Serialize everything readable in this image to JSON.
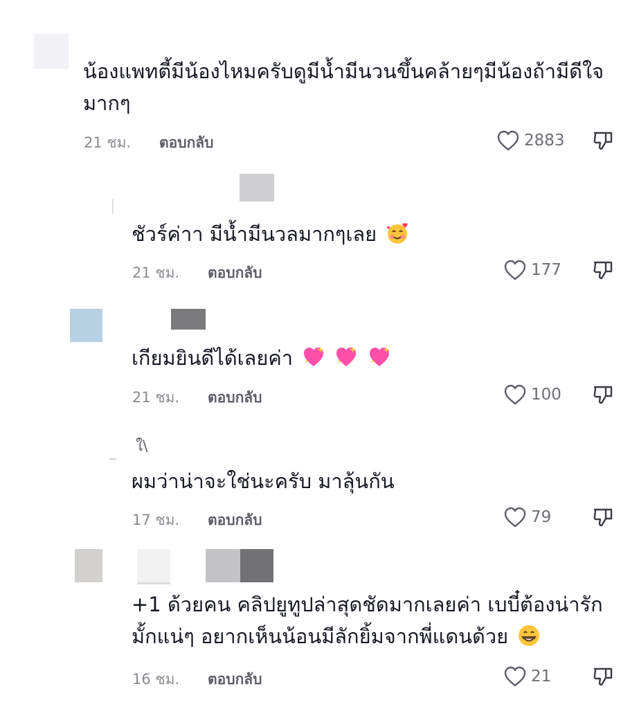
{
  "comments": [
    {
      "text": "น้องแพทตี้มีน้องไหมครับดูมีน้ำมีนวนขึ้นคล้ายๆมีน้องถ้ามีดีใจมากๆ",
      "time": "21 ชม.",
      "reply": "ตอบกลับ",
      "likes": "2883"
    },
    {
      "text": "ชัวร์ค่าา มีน้ำมีนวลมากๆเลย",
      "time": "21 ชม.",
      "reply": "ตอบกลับ",
      "likes": "177"
    },
    {
      "text": "เกียมยินดีได้เลยค่า",
      "time": "21 ชม.",
      "reply": "ตอบกลับ",
      "likes": "100"
    },
    {
      "text": "ผมว่าน่าจะใช่นะครับ มาลุ้นกัน",
      "time": "17 ชม.",
      "reply": "ตอบกลับ",
      "likes": "79"
    },
    {
      "text": "+1 ด้วยคน คลิปยูทูปล่าสุดชัดมากเลยค่า เบบี๋ต้องน่ารักมั้กแน่ๆ อยากเห็นน้อนมีลักยิ้มจากพี่แดนด้วย",
      "time": "16 ชม.",
      "reply": "ตอบกลับ",
      "likes": "21"
    }
  ],
  "reply_username_fragment": "ใ\\",
  "icons": {
    "like": "heart-outline-icon",
    "dislike": "thumbs-down-outline-icon",
    "smile_hearts": "smiling-face-with-hearts-emoji",
    "sparkling_heart": "sparkling-heart-emoji",
    "grin": "grinning-face-emoji"
  },
  "colors": {
    "text": "#161823",
    "meta": "#8a8b91",
    "heart_pink": "#ff4fa8"
  }
}
